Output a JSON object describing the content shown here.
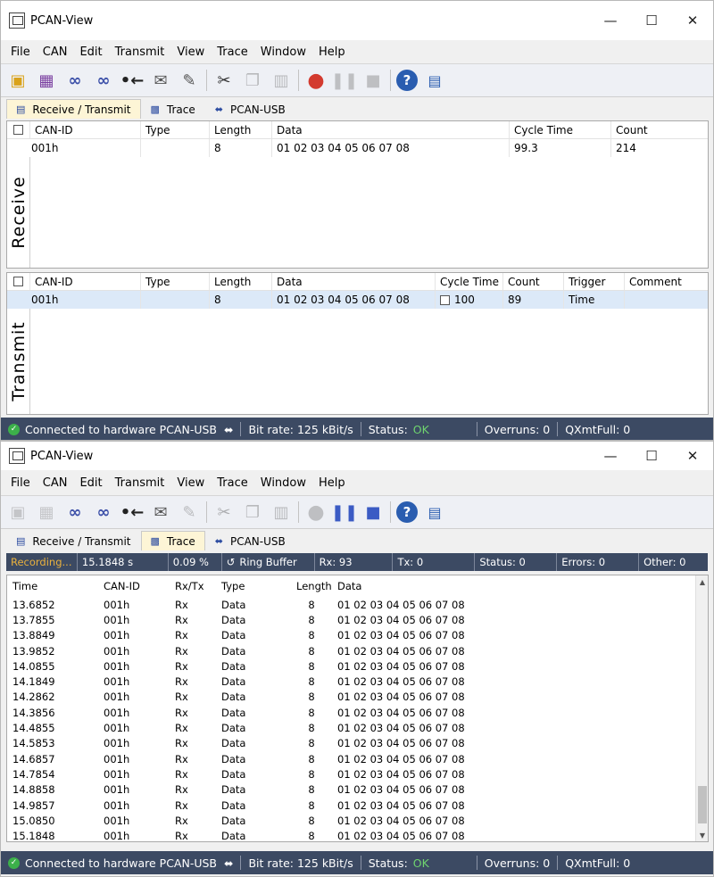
{
  "win1": {
    "title": "PCAN-View",
    "menu": [
      "File",
      "CAN",
      "Edit",
      "Transmit",
      "View",
      "Trace",
      "Window",
      "Help"
    ],
    "tabs": [
      "Receive / Transmit",
      "Trace",
      "PCAN-USB"
    ],
    "receive": {
      "label": "Receive",
      "headers": [
        "CAN-ID",
        "Type",
        "Length",
        "Data",
        "Cycle Time",
        "Count"
      ],
      "rows": [
        [
          "001h",
          "",
          "8",
          "01 02 03 04 05 06 07 08",
          "99.3",
          "214"
        ]
      ]
    },
    "transmit": {
      "label": "Transmit",
      "headers": [
        "CAN-ID",
        "Type",
        "Length",
        "Data",
        "Cycle Time",
        "Count",
        "Trigger",
        "Comment"
      ],
      "rows": [
        [
          "001h",
          "",
          "8",
          "01 02 03 04 05 06 07 08",
          "100",
          "89",
          "Time",
          ""
        ]
      ]
    },
    "status": {
      "connected": "Connected to hardware PCAN-USB",
      "bitrate": "Bit rate: 125 kBit/s",
      "status_label": "Status:",
      "status_value": "OK",
      "overruns": "Overruns: 0",
      "qxmtfull": "QXmtFull: 0"
    }
  },
  "win2": {
    "title": "PCAN-View",
    "menu": [
      "File",
      "CAN",
      "Edit",
      "Transmit",
      "View",
      "Trace",
      "Window",
      "Help"
    ],
    "tabs": [
      "Receive / Transmit",
      "Trace",
      "PCAN-USB"
    ],
    "tracebar": {
      "recording": "Recording...",
      "time": "15.1848 s",
      "percent": "0.09 %",
      "ringbuffer": "Ring Buffer",
      "rx": "Rx: 93",
      "tx": "Tx: 0",
      "status": "Status: 0",
      "errors": "Errors: 0",
      "other": "Other: 0"
    },
    "trace": {
      "headers": [
        "Time",
        "CAN-ID",
        "Rx/Tx",
        "Type",
        "Length",
        "Data"
      ],
      "rows": [
        [
          "13.6852",
          "001h",
          "Rx",
          "Data",
          "8",
          "01 02 03 04 05 06 07 08"
        ],
        [
          "13.7855",
          "001h",
          "Rx",
          "Data",
          "8",
          "01 02 03 04 05 06 07 08"
        ],
        [
          "13.8849",
          "001h",
          "Rx",
          "Data",
          "8",
          "01 02 03 04 05 06 07 08"
        ],
        [
          "13.9852",
          "001h",
          "Rx",
          "Data",
          "8",
          "01 02 03 04 05 06 07 08"
        ],
        [
          "14.0855",
          "001h",
          "Rx",
          "Data",
          "8",
          "01 02 03 04 05 06 07 08"
        ],
        [
          "14.1849",
          "001h",
          "Rx",
          "Data",
          "8",
          "01 02 03 04 05 06 07 08"
        ],
        [
          "14.2862",
          "001h",
          "Rx",
          "Data",
          "8",
          "01 02 03 04 05 06 07 08"
        ],
        [
          "14.3856",
          "001h",
          "Rx",
          "Data",
          "8",
          "01 02 03 04 05 06 07 08"
        ],
        [
          "14.4855",
          "001h",
          "Rx",
          "Data",
          "8",
          "01 02 03 04 05 06 07 08"
        ],
        [
          "14.5853",
          "001h",
          "Rx",
          "Data",
          "8",
          "01 02 03 04 05 06 07 08"
        ],
        [
          "14.6857",
          "001h",
          "Rx",
          "Data",
          "8",
          "01 02 03 04 05 06 07 08"
        ],
        [
          "14.7854",
          "001h",
          "Rx",
          "Data",
          "8",
          "01 02 03 04 05 06 07 08"
        ],
        [
          "14.8858",
          "001h",
          "Rx",
          "Data",
          "8",
          "01 02 03 04 05 06 07 08"
        ],
        [
          "14.9857",
          "001h",
          "Rx",
          "Data",
          "8",
          "01 02 03 04 05 06 07 08"
        ],
        [
          "15.0850",
          "001h",
          "Rx",
          "Data",
          "8",
          "01 02 03 04 05 06 07 08"
        ],
        [
          "15.1848",
          "001h",
          "Rx",
          "Data",
          "8",
          "01 02 03 04 05 06 07 08"
        ]
      ]
    },
    "status": {
      "connected": "Connected to hardware PCAN-USB",
      "bitrate": "Bit rate: 125 kBit/s",
      "status_label": "Status:",
      "status_value": "OK",
      "overruns": "Overruns: 0",
      "qxmtfull": "QXmtFull: 0"
    }
  },
  "icons": {
    "window_buttons": [
      "minimize-icon",
      "maximize-icon",
      "close-icon"
    ],
    "toolbar": [
      "new-project-icon",
      "save-icon",
      "connect-icon",
      "disconnect-icon",
      "reset-icon",
      "message-icon",
      "edit-message-icon",
      "cut-icon",
      "copy-icon",
      "paste-icon",
      "record-icon",
      "pause-icon",
      "stop-icon",
      "help-icon",
      "info-icon"
    ]
  },
  "colors": {
    "statusbar": "#3c4a63",
    "ok": "#6fd36f",
    "selected_row": "#dce9f8",
    "active_tab": "#fdf5d6",
    "record": "#d33a2f"
  }
}
